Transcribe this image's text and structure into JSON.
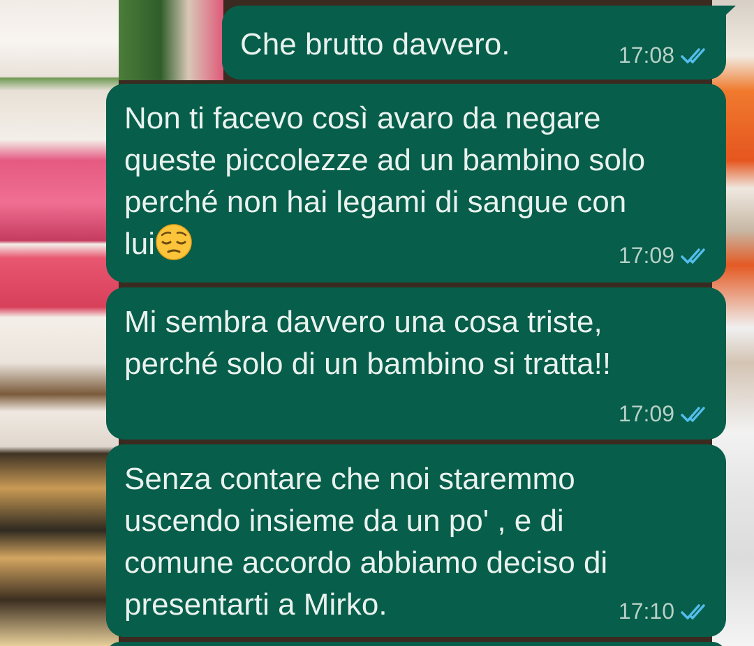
{
  "messages": [
    {
      "text": "Che brutto davvero.",
      "time": "17:08",
      "status": "read"
    },
    {
      "text": "Non ti facevo così avaro da negare\nqueste piccolezze ad un bambino solo\nperché non hai legami di sangue con\nlui",
      "emoji": "pensive-face",
      "time": "17:09",
      "status": "read"
    },
    {
      "text": "Mi sembra davvero una cosa triste,\nperché solo di un bambino si tratta!!",
      "time": "17:09",
      "status": "read"
    },
    {
      "text": "Senza contare che noi staremmo\nuscendo insieme da un po' , e di\ncomune accordo abbiamo deciso di\npresentarti a Mirko.",
      "time": "17:10",
      "status": "read"
    }
  ],
  "colors": {
    "bubble": "#075e4a",
    "text": "#e9f2ee",
    "meta": "#b7d0c7",
    "read_ticks": "#53bdeb"
  },
  "icons": {
    "read_receipt": "double-check-icon",
    "emoji": "pensive-face-emoji"
  }
}
